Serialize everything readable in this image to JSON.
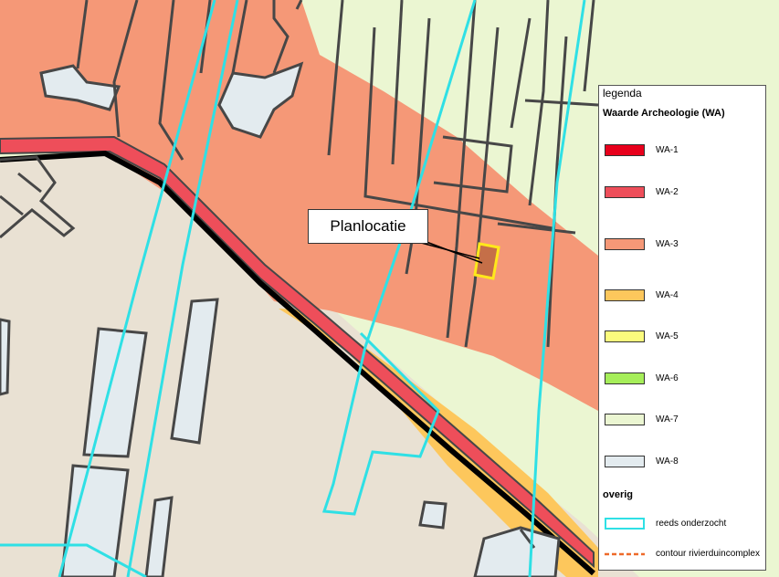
{
  "map": {
    "colors": {
      "wa1": "#e8001b",
      "wa2": "#ee4e5a",
      "wa3": "#f59877",
      "wa4": "#fdc75c",
      "wa5": "#fbfb7d",
      "wa6": "#a6ee5a",
      "wa7": "#ebf6d2",
      "wa8": "#e3ebef",
      "base": "#e9e1d3",
      "parcel_line": "#474747",
      "onderzocht": "#2fe0e5",
      "contour": "#ee6a2a",
      "planlocatie_fill": "#c56f48",
      "planlocatie_outline": "#ffe81b"
    },
    "planlocatie_label": "Planlocatie"
  },
  "legend": {
    "title": "legenda",
    "subtitle": "Waarde Archeologie (WA)",
    "items": [
      {
        "label": "WA-1",
        "color": "#e8001b"
      },
      {
        "label": "WA-2",
        "color": "#ee4e5a"
      },
      {
        "label": "WA-3",
        "color": "#f59877"
      },
      {
        "label": "WA-4",
        "color": "#fdc75c"
      },
      {
        "label": "WA-5",
        "color": "#fbfb7d"
      },
      {
        "label": "WA-6",
        "color": "#a6ee5a"
      },
      {
        "label": "WA-7",
        "color": "#ebf6d2"
      },
      {
        "label": "WA-8",
        "color": "#e3ebef"
      }
    ],
    "overig_title": "overig",
    "overig_items": [
      {
        "label": "reeds onderzocht",
        "style": "cyan-outline"
      },
      {
        "label": "contour rivierduincomplex",
        "style": "orange-dashed"
      }
    ]
  }
}
